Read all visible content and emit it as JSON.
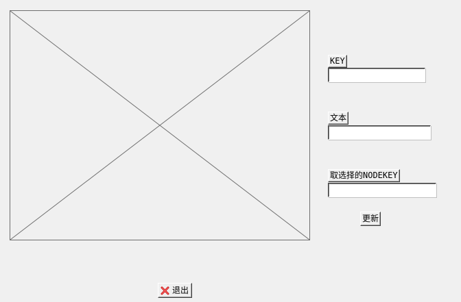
{
  "form": {
    "key_label": "KEY",
    "key_value": "",
    "text_label": "文本",
    "text_value": "",
    "nodekey_label": "取选择的NODEKEY",
    "nodekey_value": "",
    "update_label": "更新"
  },
  "footer": {
    "exit_label": "退出",
    "exit_icon": "close-icon",
    "exit_icon_color": "#cc1f1f"
  }
}
